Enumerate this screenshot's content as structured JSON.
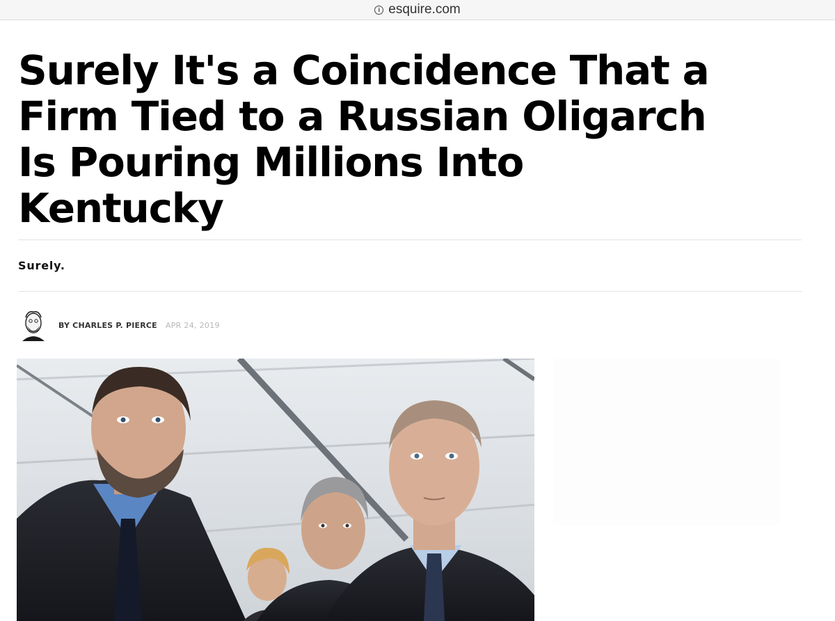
{
  "browser": {
    "url": "esquire.com"
  },
  "article": {
    "headline_lines": [
      "Surely It's a Coincidence That a",
      "Firm Tied to a Russian Oligarch",
      "Is Pouring Millions Into",
      "Kentucky"
    ],
    "dek": "Surely.",
    "byline": {
      "author": "BY CHARLES P. PIERCE",
      "date": "APR 24, 2019"
    },
    "hero_image": {
      "subject": "photo-of-three-men-under-tent-roof"
    }
  },
  "colors": {
    "headline": "#000000",
    "divider": "#e3e3e3",
    "date": "#b8b8b8",
    "url_bar": "#f6f6f6"
  }
}
